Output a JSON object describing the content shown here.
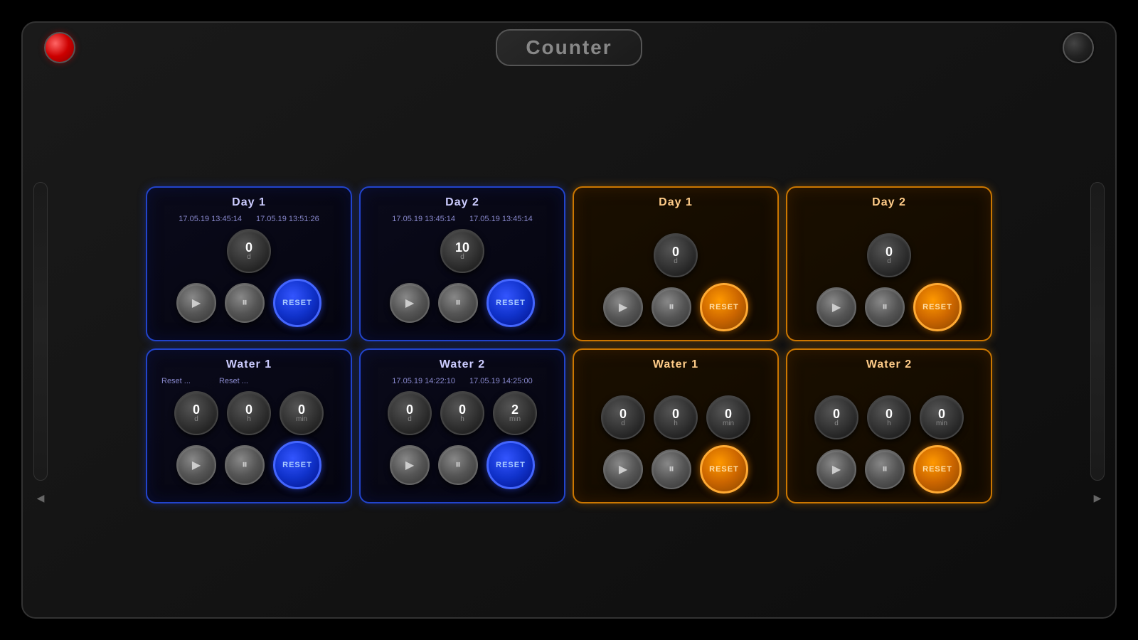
{
  "app": {
    "title": "Counter"
  },
  "blue_section": {
    "day1": {
      "title": "Day 1",
      "timestamp1": "17.05.19 13:45:14",
      "timestamp2": "17.05.19 13:51:26",
      "dial": {
        "value": "0",
        "label": "d"
      },
      "play_label": "▶",
      "pause_label": "⏸",
      "reset_label": "RESET"
    },
    "day2": {
      "title": "Day 2",
      "timestamp1": "17.05.19 13:45:14",
      "timestamp2": "17.05.19 13:45:14",
      "dial": {
        "value": "10",
        "label": "d"
      },
      "play_label": "▶",
      "pause_label": "⏸",
      "reset_label": "RESET"
    },
    "water1": {
      "title": "Water 1",
      "reset1": "Reset ...",
      "reset2": "Reset ...",
      "dials": [
        {
          "value": "0",
          "label": "d"
        },
        {
          "value": "0",
          "label": "h"
        },
        {
          "value": "0",
          "label": "min"
        }
      ],
      "play_label": "▶",
      "pause_label": "⏸",
      "reset_label": "RESET"
    },
    "water2": {
      "title": "Water 2",
      "timestamp1": "17.05.19 14:22:10",
      "timestamp2": "17.05.19 14:25:00",
      "dials": [
        {
          "value": "0",
          "label": "d"
        },
        {
          "value": "0",
          "label": "h"
        },
        {
          "value": "2",
          "label": "min"
        }
      ],
      "play_label": "▶",
      "pause_label": "⏸",
      "reset_label": "RESET"
    }
  },
  "orange_section": {
    "day1": {
      "title": "Day 1",
      "dial": {
        "value": "0",
        "label": "d"
      },
      "play_label": "▶",
      "pause_label": "⏸",
      "reset_label": "RESET"
    },
    "day2": {
      "title": "Day 2",
      "dial": {
        "value": "0",
        "label": "d"
      },
      "play_label": "▶",
      "pause_label": "⏸",
      "reset_label": "RESET"
    },
    "water1": {
      "title": "Water 1",
      "dials": [
        {
          "value": "0",
          "label": "d"
        },
        {
          "value": "0",
          "label": "h"
        },
        {
          "value": "0",
          "label": "min"
        }
      ],
      "play_label": "▶",
      "pause_label": "⏸",
      "reset_label": "RESET"
    },
    "water2": {
      "title": "Water 2",
      "dials": [
        {
          "value": "0",
          "label": "d"
        },
        {
          "value": "0",
          "label": "h"
        },
        {
          "value": "0",
          "label": "min"
        }
      ],
      "play_label": "▶",
      "pause_label": "⏸",
      "reset_label": "RESET"
    }
  }
}
